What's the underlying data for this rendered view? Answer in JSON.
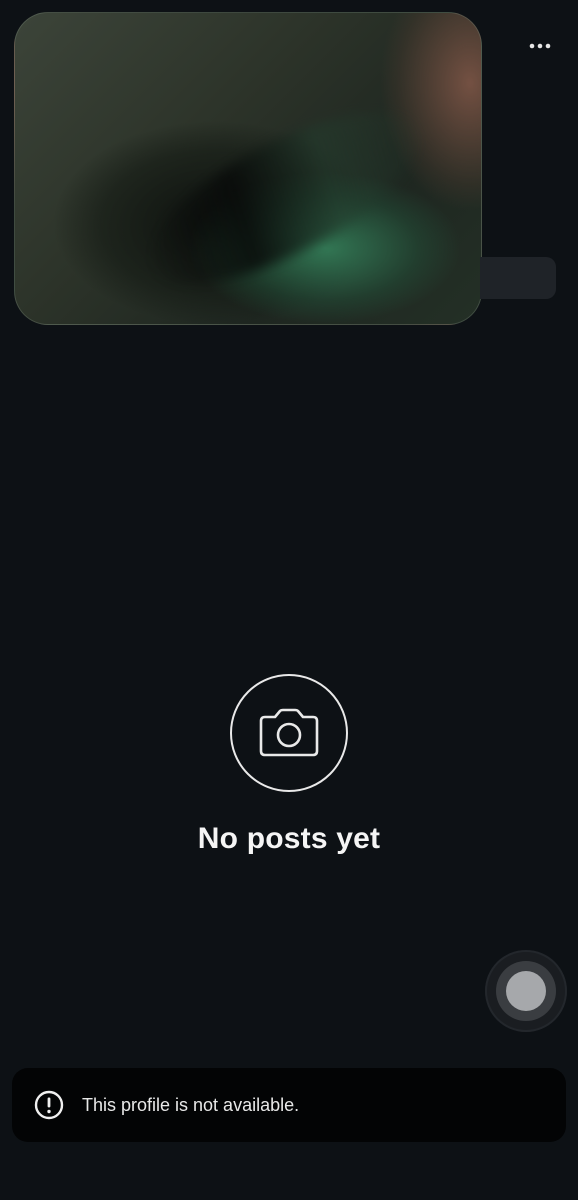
{
  "header": {
    "more_icon": "more-horizontal-icon"
  },
  "video_preview": {
    "description_icon": "video-thumbnail"
  },
  "empty_state": {
    "icon": "camera-icon",
    "title": "No posts yet"
  },
  "fab": {
    "icon": "floating-dot-button"
  },
  "toast": {
    "icon": "alert-circle-icon",
    "message": "This profile is not available."
  },
  "colors": {
    "background": "#0d1115",
    "toast_background": "#030405",
    "text_primary": "#f5f5f5"
  }
}
